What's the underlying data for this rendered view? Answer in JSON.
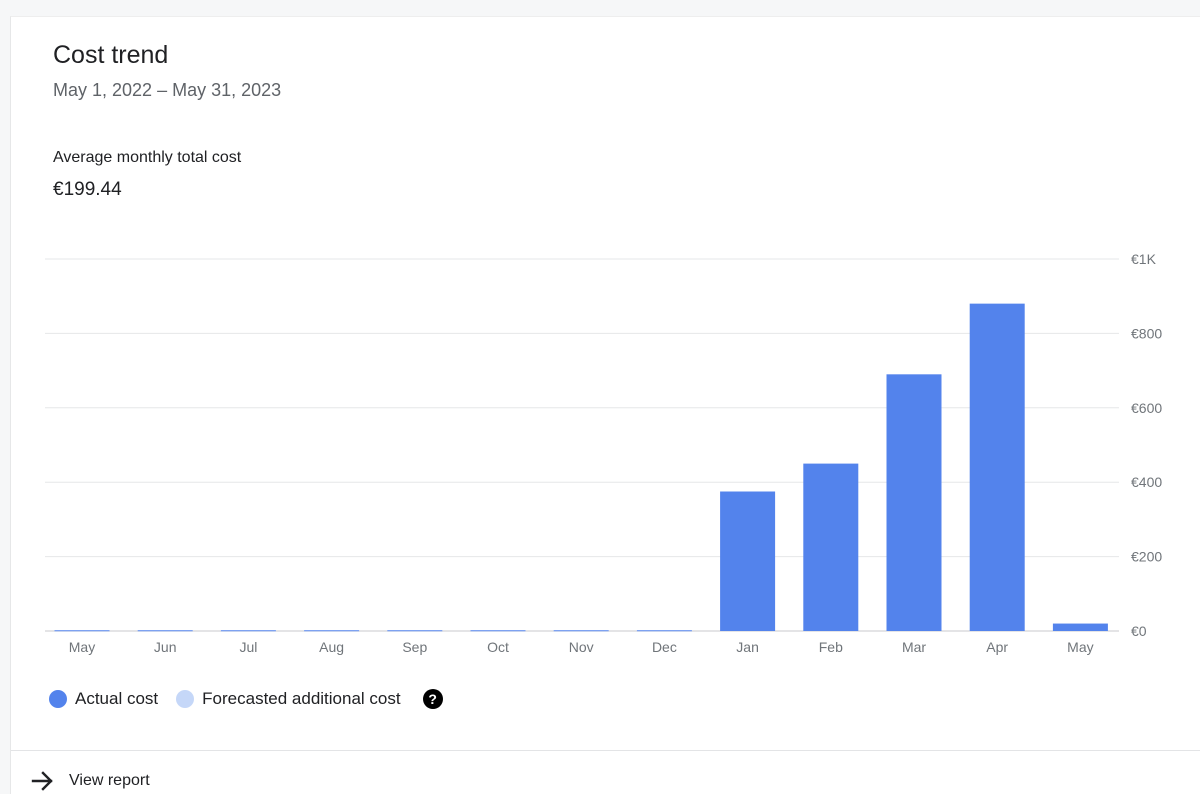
{
  "card": {
    "title": "Cost trend",
    "date_range": "May 1, 2022 – May 31, 2023",
    "average_label": "Average monthly total cost",
    "average_value": "€199.44"
  },
  "legend": {
    "actual_label": "Actual cost",
    "forecast_label": "Forecasted additional cost",
    "help_glyph": "?",
    "help_icon": "help-circle-icon"
  },
  "footer": {
    "view_report_label": "View report",
    "view_report_icon": "arrow-right-icon"
  },
  "colors": {
    "actual": "#5383ec",
    "forecast": "#c5d7f8",
    "grid": "#e6e7e8",
    "axis_text": "#70757a"
  },
  "chart_data": {
    "type": "bar",
    "categories": [
      "May",
      "Jun",
      "Jul",
      "Aug",
      "Sep",
      "Oct",
      "Nov",
      "Dec",
      "Jan",
      "Feb",
      "Mar",
      "Apr",
      "May"
    ],
    "series": [
      {
        "name": "Actual cost",
        "values": [
          2,
          2,
          2,
          2,
          2,
          2,
          2,
          2,
          375,
          450,
          690,
          880,
          20
        ]
      }
    ],
    "y_ticks": [
      "€0",
      "€200",
      "€400",
      "€600",
      "€800",
      "€1K"
    ],
    "y_tick_values": [
      0,
      200,
      400,
      600,
      800,
      1000
    ],
    "ylim": [
      0,
      1000
    ],
    "y_axis_position": "right",
    "grid": true,
    "legend_position": "bottom-left",
    "title": "",
    "xlabel": "",
    "ylabel": ""
  }
}
